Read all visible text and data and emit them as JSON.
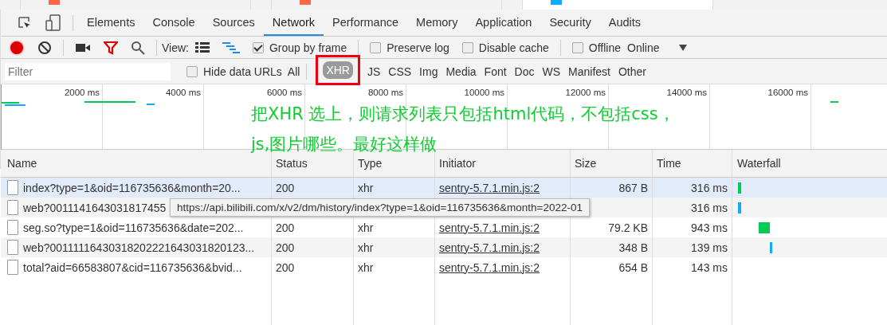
{
  "browser_tabs": [
    {
      "selected": false
    },
    {
      "selected": false
    },
    {
      "selected": true
    }
  ],
  "devtools_tabs": [
    {
      "label": "Elements",
      "selected": false
    },
    {
      "label": "Console",
      "selected": false
    },
    {
      "label": "Sources",
      "selected": false
    },
    {
      "label": "Network",
      "selected": true
    },
    {
      "label": "Performance",
      "selected": false
    },
    {
      "label": "Memory",
      "selected": false
    },
    {
      "label": "Application",
      "selected": false
    },
    {
      "label": "Security",
      "selected": false
    },
    {
      "label": "Audits",
      "selected": false
    }
  ],
  "toolbar": {
    "recording": true,
    "view_label": "View:",
    "group_by_frame": {
      "label": "Group by frame",
      "checked": true
    },
    "preserve_log": {
      "label": "Preserve log",
      "checked": false
    },
    "disable_cache": {
      "label": "Disable cache",
      "checked": false
    },
    "offline": {
      "label": "Offline",
      "checked": false
    },
    "throttling": "Online"
  },
  "filter": {
    "placeholder": "Filter",
    "hide_data_urls": {
      "label": "Hide data URLs",
      "checked": false
    },
    "types": [
      {
        "label": "All",
        "selected": false
      },
      {
        "label": "XHR",
        "selected": true
      },
      {
        "label": "JS",
        "selected": false
      },
      {
        "label": "CSS",
        "selected": false
      },
      {
        "label": "Img",
        "selected": false
      },
      {
        "label": "Media",
        "selected": false
      },
      {
        "label": "Font",
        "selected": false
      },
      {
        "label": "Doc",
        "selected": false
      },
      {
        "label": "WS",
        "selected": false
      },
      {
        "label": "Manifest",
        "selected": false
      },
      {
        "label": "Other",
        "selected": false
      }
    ]
  },
  "timeline": {
    "ticks": [
      "2000 ms",
      "4000 ms",
      "6000 ms",
      "8000 ms",
      "10000 ms",
      "12000 ms",
      "14000 ms",
      "16000 ms"
    ]
  },
  "annotation": [
    "把XHR 选上，则请求列表只包括html代码，不包括css，",
    "js,图片哪些。最好这样做"
  ],
  "table": {
    "columns": [
      "Name",
      "Status",
      "Type",
      "Initiator",
      "Size",
      "Time",
      "Waterfall"
    ],
    "rows": [
      {
        "name": "index?type=1&oid=116735636&month=20...",
        "status": "200",
        "type": "xhr",
        "initiator": "sentry-5.7.1.min.js:2",
        "size": "867 B",
        "time": "316 ms",
        "selected": true
      },
      {
        "name": "web?0011141643031817455",
        "time": "316 ms",
        "selected": false
      },
      {
        "name": "seg.so?type=1&oid=116735636&date=202...",
        "status": "200",
        "type": "xhr",
        "initiator": "sentry-5.7.1.min.js:2",
        "size": "79.2 KB",
        "time": "943 ms",
        "selected": false
      },
      {
        "name": "web?00111116430318202221643031820123...",
        "status": "200",
        "type": "xhr",
        "initiator": "sentry-5.7.1.min.js:2",
        "size": "348 B",
        "time": "139 ms",
        "selected": false
      },
      {
        "name": "total?aid=66583807&cid=116735636&bvid...",
        "status": "200",
        "type": "xhr",
        "initiator": "sentry-5.7.1.min.js:2",
        "size": "654 B",
        "time": "143 ms",
        "selected": false
      }
    ]
  },
  "tooltip": "https://api.bilibili.com/x/v2/dm/history/index?type=1&oid=116735636&month=2022-01"
}
